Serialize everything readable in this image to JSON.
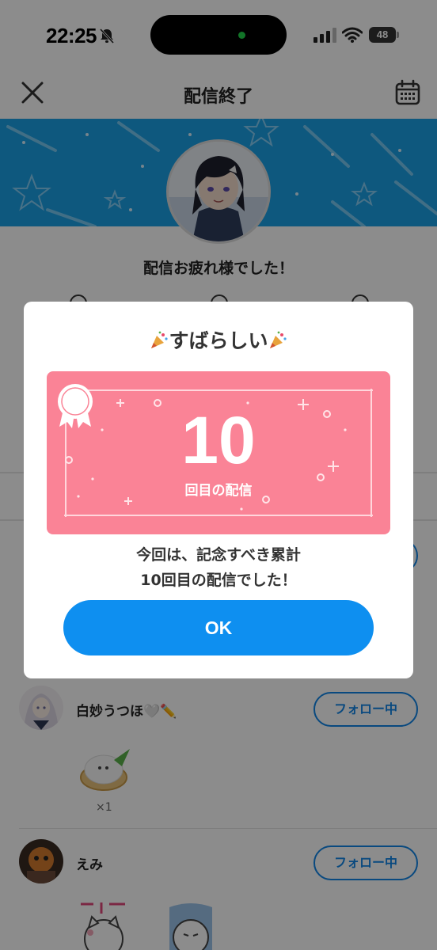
{
  "status_bar": {
    "time": "22:25",
    "battery": "48"
  },
  "header": {
    "title": "配信終了"
  },
  "main": {
    "thanks": "配信お疲れ様でした！"
  },
  "viewers": [
    {
      "name": "白妙うつほ🤍✏️",
      "follow_label": "フォロー中",
      "gift_count": "×1"
    },
    {
      "name": "えみ",
      "follow_label": "フォロー中"
    }
  ],
  "modal": {
    "title": "すばらしい",
    "card_number": "10",
    "card_subtitle": "回目の配信",
    "message_line1": "今回は、記念すべき累計",
    "message_line2": "10回目の配信でした！",
    "ok_label": "OK"
  },
  "colors": {
    "banner": "#1aa0e6",
    "card": "#fa8396",
    "ok_button": "#0e8ff0",
    "follow_border": "#1286e8"
  }
}
